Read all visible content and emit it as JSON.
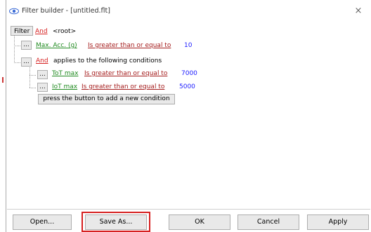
{
  "window": {
    "title": "Filter builder - [untitled.flt]",
    "close_glyph": "×"
  },
  "tree": {
    "filter_label": "Filter",
    "root_operator": "And",
    "root_label": "<root>",
    "conditions": [
      {
        "field": "Max. Acc. (g)",
        "operator": "Is greater than or equal to",
        "value": "10"
      }
    ],
    "group": {
      "operator": "And",
      "label": "applies to the following conditions",
      "conditions": [
        {
          "field": "ToT max",
          "operator": "Is greater than or equal to",
          "value": "7000"
        },
        {
          "field": "IoT max",
          "operator": "Is greater than or equal to",
          "value": "5000"
        }
      ]
    },
    "dots_label": "...",
    "add_condition_label": "press the button to add a new condition"
  },
  "footer": {
    "open_label": "Open...",
    "save_as_label": "Save As...",
    "ok_label": "OK",
    "cancel_label": "Cancel",
    "apply_label": "Apply"
  },
  "colors": {
    "operator_red": "#d62020",
    "field_green": "#1f8a1f",
    "condition_darkred": "#a41c1c",
    "value_blue": "#1a1aff",
    "highlight_red": "#d62020"
  },
  "icons": {
    "title": "eye-icon",
    "close": "close-icon"
  }
}
